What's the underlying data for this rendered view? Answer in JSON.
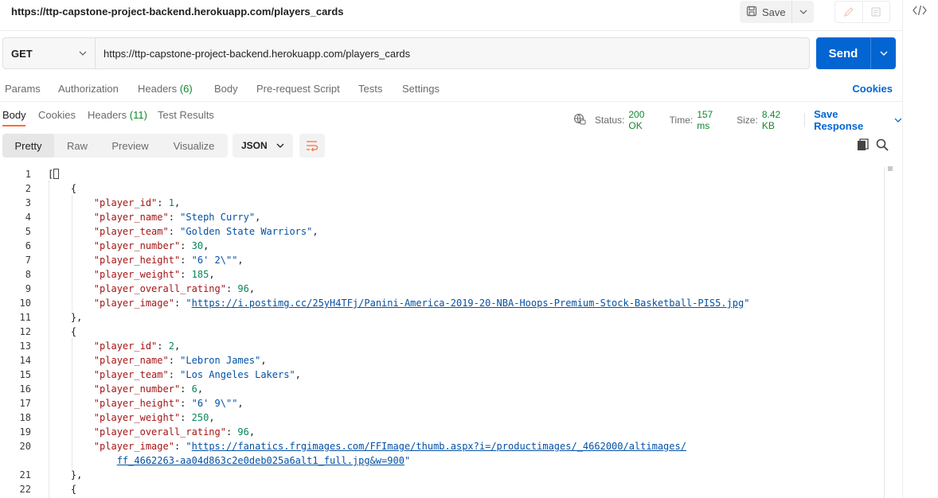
{
  "request": {
    "title": "https://ttp-capstone-project-backend.herokuapp.com/players_cards",
    "method": "GET",
    "url": "https://ttp-capstone-project-backend.herokuapp.com/players_cards",
    "save_label": "Save",
    "send_label": "Send"
  },
  "request_tabs": {
    "params": "Params",
    "authorization": "Authorization",
    "headers": "Headers",
    "headers_count": "(6)",
    "body": "Body",
    "prerequest": "Pre-request Script",
    "tests": "Tests",
    "settings": "Settings",
    "cookies": "Cookies"
  },
  "response_tabs": {
    "body": "Body",
    "cookies": "Cookies",
    "headers": "Headers",
    "headers_count": "(11)",
    "test_results": "Test Results"
  },
  "response_meta": {
    "status_label": "Status:",
    "status_value": "200 OK",
    "time_label": "Time:",
    "time_value": "157 ms",
    "size_label": "Size:",
    "size_value": "8.42 KB",
    "save_response": "Save Response"
  },
  "view": {
    "pretty": "Pretty",
    "raw": "Raw",
    "preview": "Preview",
    "visualize": "Visualize",
    "format": "JSON"
  },
  "code_lines": {
    "l3_key": "\"player_id\"",
    "l3_val": "1",
    "l4_key": "\"player_name\"",
    "l4_val": "\"Steph Curry\"",
    "l5_key": "\"player_team\"",
    "l5_val": "\"Golden State Warriors\"",
    "l6_key": "\"player_number\"",
    "l6_val": "30",
    "l7_key": "\"player_height\"",
    "l7_val": "\"6' 2\\\"\"",
    "l8_key": "\"player_weight\"",
    "l8_val": "185",
    "l9_key": "\"player_overall_rating\"",
    "l9_val": "96",
    "l10_key": "\"player_image\"",
    "l10_url": "https://i.postimg.cc/25yH4TFj/Panini-America-2019-20-NBA-Hoops-Premium-Stock-Basketball-PIS5.jpg",
    "l13_key": "\"player_id\"",
    "l13_val": "2",
    "l14_key": "\"player_name\"",
    "l14_val": "\"Lebron James\"",
    "l15_key": "\"player_team\"",
    "l15_val": "\"Los Angeles Lakers\"",
    "l16_key": "\"player_number\"",
    "l16_val": "6",
    "l17_key": "\"player_height\"",
    "l17_val": "\"6' 9\\\"\"",
    "l18_key": "\"player_weight\"",
    "l18_val": "250",
    "l19_key": "\"player_overall_rating\"",
    "l19_val": "96",
    "l20_key": "\"player_image\"",
    "l20_url_a": "https://fanatics.frgimages.com/FFImage/thumb.aspx?i=/productimages/_4662000/altimages/",
    "l20_url_b": "ff_4662263-aa04d863c2e0deb025a6alt1_full.jpg&w=900"
  },
  "line_numbers": [
    "1",
    "2",
    "3",
    "4",
    "5",
    "6",
    "7",
    "8",
    "9",
    "10",
    "11",
    "12",
    "13",
    "14",
    "15",
    "16",
    "17",
    "18",
    "19",
    "20",
    "21",
    "22"
  ],
  "colors": {
    "accent": "#0265d2",
    "tab_active": "#ff6c37",
    "status_ok": "#0f8a2e",
    "json_key": "#a31515",
    "json_string": "#0451a5",
    "json_number": "#098658"
  }
}
